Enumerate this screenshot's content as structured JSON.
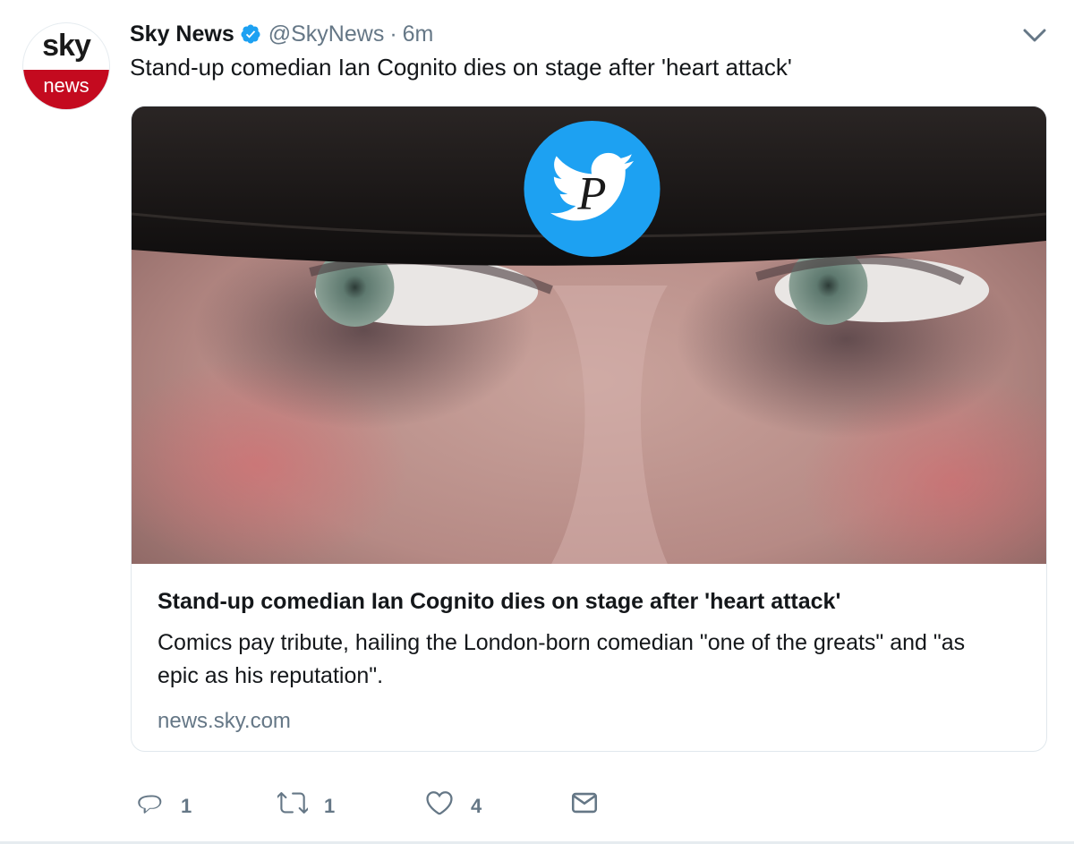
{
  "tweet": {
    "avatar": {
      "line1": "sky",
      "line2": "news",
      "brand_red": "#c40a1f"
    },
    "author_name": "Sky News",
    "verified_icon": "verified-badge-icon",
    "handle": "@SkyNews",
    "separator": "·",
    "time": "6m",
    "text": "Stand-up comedian Ian Cognito dies on stage after 'heart attack'"
  },
  "card": {
    "image_description_icon": "man-face-photo",
    "overlay_logo": "twitter-bird-logo",
    "title": "Stand-up comedian Ian Cognito dies on stage after 'heart attack'",
    "description": "Comics pay tribute, hailing the London-born comedian \"one of the greats\" and \"as epic as his reputation\".",
    "domain": "news.sky.com"
  },
  "actions": {
    "reply_count": "1",
    "retweet_count": "1",
    "like_count": "4"
  },
  "colors": {
    "secondary_text": "#657786",
    "twitter_blue": "#1da1f2",
    "border": "#e1e8ed"
  }
}
